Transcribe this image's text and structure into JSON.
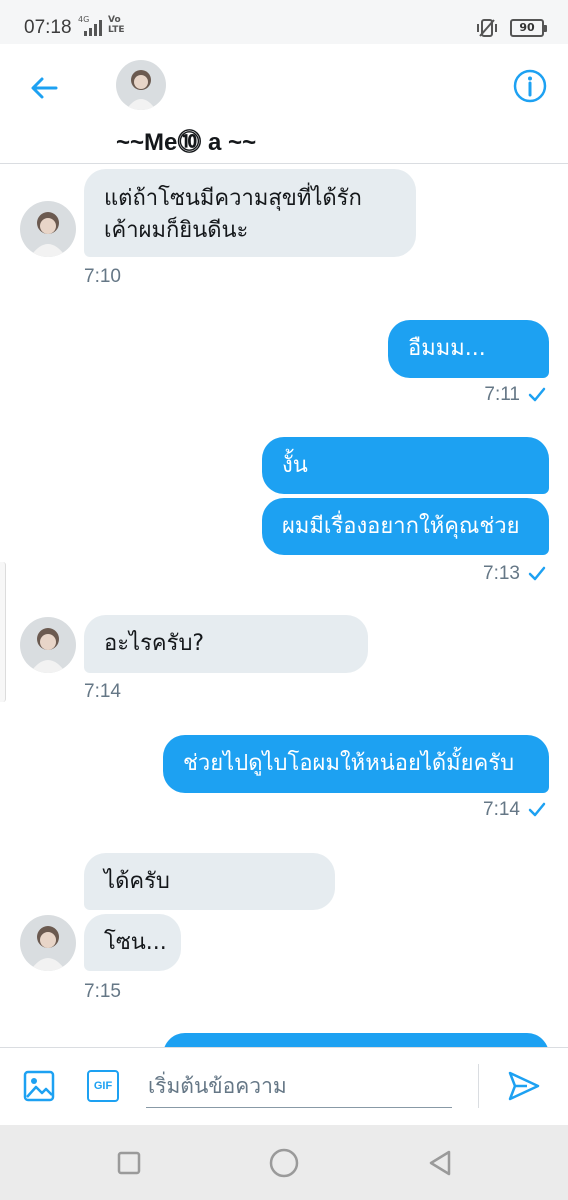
{
  "status_bar": {
    "time": "07:18",
    "network": "4G",
    "volte": "Vo LTE",
    "battery": "90"
  },
  "header": {
    "name": "~~Me⓾ a ~~"
  },
  "messages": [
    {
      "direction": "in",
      "text": "แต่ถ้าโซนมีความสุขที่ได้รัก เค้าผมก็ยินดีนะ",
      "time": "7:10"
    },
    {
      "direction": "out",
      "text": "อืมมม...",
      "time": "7:11"
    },
    {
      "direction": "out",
      "text": "งั้น"
    },
    {
      "direction": "out",
      "text": "ผมมีเรื่องอยากให้คุณช่วย",
      "time": "7:13"
    },
    {
      "direction": "in",
      "text": "อะไรครับ?",
      "time": "7:14"
    },
    {
      "direction": "out",
      "text": "ช่วยไปดูไบโอผมให้หน่อยได้มั้ยครับ",
      "time": "7:14"
    },
    {
      "direction": "in",
      "text": "ได้ครับ"
    },
    {
      "direction": "in",
      "text": "โซน...",
      "time": "7:15"
    }
  ],
  "composer": {
    "placeholder": "เริ่มต้นข้อความ",
    "gif_label": "GIF"
  },
  "colors": {
    "accent": "#1da1f2",
    "incoming_bubble": "#e6ecf0",
    "timestamp": "#657786"
  },
  "icons": {
    "back": "arrow-left-icon",
    "info": "info-icon",
    "image": "image-icon",
    "gif": "gif-icon",
    "send": "send-icon",
    "read": "check-icon"
  }
}
